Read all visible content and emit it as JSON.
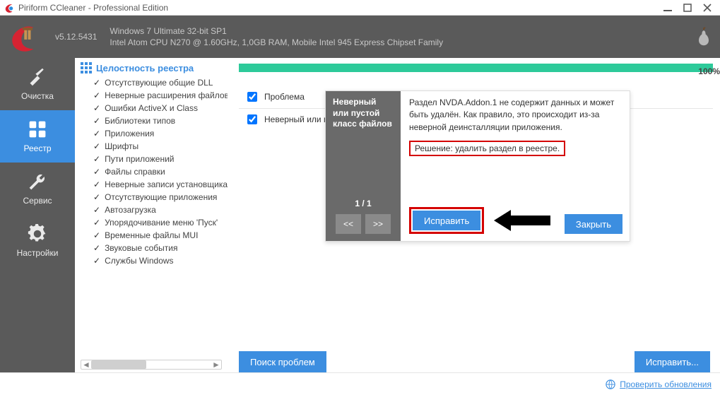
{
  "titlebar": {
    "text": "Piriform CCleaner - Professional Edition"
  },
  "header": {
    "version": "v5.12.5431",
    "sys1": "Windows 7 Ultimate 32-bit SP1",
    "sys2": "Intel Atom CPU N270 @ 1.60GHz, 1,0GB RAM, Mobile Intel 945 Express Chipset Family"
  },
  "nav": [
    {
      "id": "clean",
      "label": "Очистка"
    },
    {
      "id": "registry",
      "label": "Реестр"
    },
    {
      "id": "service",
      "label": "Сервис"
    },
    {
      "id": "settings",
      "label": "Настройки"
    }
  ],
  "side": {
    "heading": "Целостность реестра",
    "items": [
      "Отсутствующие общие DLL",
      "Неверные расширения файлов",
      "Ошибки ActiveX и Class",
      "Библиотеки типов",
      "Приложения",
      "Шрифты",
      "Пути приложений",
      "Файлы справки",
      "Неверные записи установщика",
      "Отсутствующие приложения",
      "Автозагрузка",
      "Упорядочивание меню 'Пуск'",
      "Временные файлы MUI",
      "Звуковые события",
      "Службы Windows"
    ]
  },
  "progress": {
    "percent": "100%"
  },
  "results": {
    "header": "Проблема",
    "rows": [
      {
        "name": "Неверный или пустой класс файлов"
      }
    ]
  },
  "detail": {
    "heading": "Неверный или пустой класс файлов",
    "counter": "1 / 1",
    "prev": "<<",
    "next": ">>",
    "description": "Раздел NVDA.Addon.1 не содержит данных и может быть удалён. Как правило, это происходит из-за неверной деинсталляции приложения.",
    "solution": "Решение: удалить раздел в реестре.",
    "fix": "Исправить",
    "close": "Закрыть"
  },
  "buttons": {
    "scan": "Поиск проблем",
    "fixall": "Исправить..."
  },
  "status": {
    "check_updates": "Проверить обновления"
  }
}
